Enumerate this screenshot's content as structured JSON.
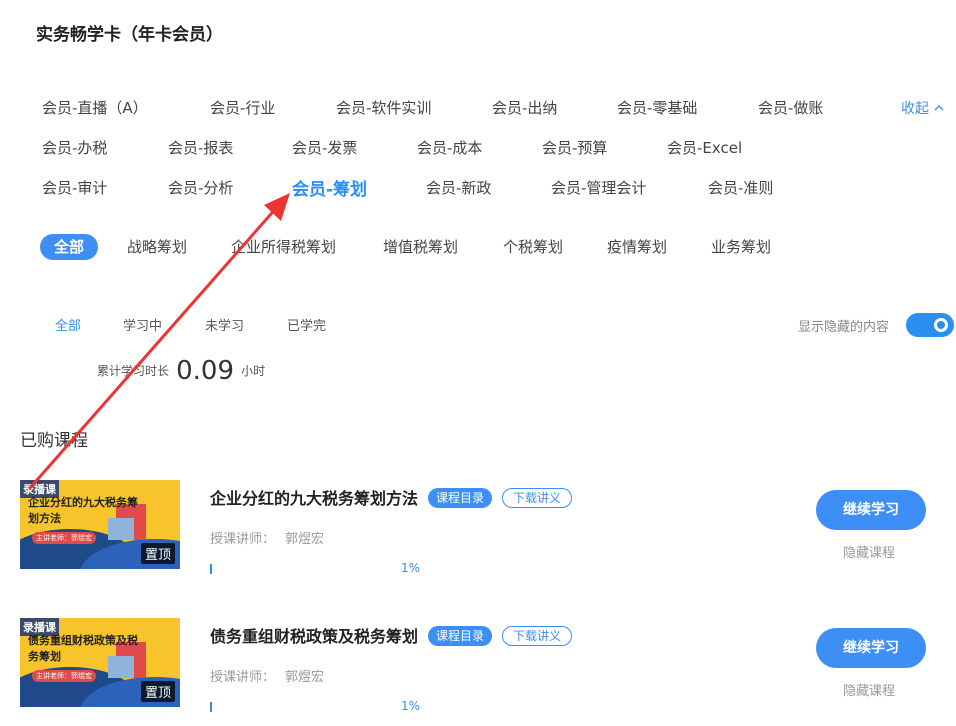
{
  "page_title": "实务畅学卡（年卡会员）",
  "categories": {
    "rows": [
      [
        "会员-直播（A）",
        "会员-行业",
        "会员-软件实训",
        "会员-出纳",
        "会员-零基础",
        "会员-做账"
      ],
      [
        "会员-办税",
        "会员-报表",
        "会员-发票",
        "会员-成本",
        "会员-预算",
        "会员-Excel"
      ],
      [
        "会员-审计",
        "会员-分析",
        "会员-筹划",
        "会员-新政",
        "会员-管理会计",
        "会员-准则"
      ]
    ],
    "active": "会员-筹划",
    "collapse_label": "收起"
  },
  "subcategories": {
    "items": [
      "全部",
      "战略筹划",
      "企业所得税筹划",
      "增值税筹划",
      "个税筹划",
      "疫情筹划",
      "业务筹划"
    ],
    "active": "全部"
  },
  "filters": {
    "items": [
      "全部",
      "学习中",
      "未学习",
      "已学完"
    ],
    "active": "全部"
  },
  "hidden_toggle": {
    "label": "显示隐藏的内容",
    "on": true
  },
  "study_time": {
    "label": "累计学习时长",
    "value": "0.09",
    "unit": "小时"
  },
  "section_title": "已购课程",
  "courses": [
    {
      "thumb_tag": "录播课",
      "thumb_title": "企业分红的九大税务筹划方法",
      "thumb_teacher_chip": "主讲老师：郭煜宏",
      "pin_tag": "置顶",
      "title": "企业分红的九大税务筹划方法",
      "catalog_label": "课程目录",
      "handout_label": "下载讲义",
      "teacher_label": "授课讲师：",
      "teacher_name": "郭煜宏",
      "progress_text": "1%",
      "progress": 0.01,
      "continue_label": "继续学习",
      "hide_label": "隐藏课程"
    },
    {
      "thumb_tag": "录播课",
      "thumb_title": "债务重组财税政策及税务筹划",
      "thumb_teacher_chip": "主讲老师：郭煜宏",
      "pin_tag": "置顶",
      "title": "债务重组财税政策及税务筹划",
      "catalog_label": "课程目录",
      "handout_label": "下载讲义",
      "teacher_label": "授课讲师：",
      "teacher_name": "郭煜宏",
      "progress_text": "1%",
      "progress": 0.01,
      "continue_label": "继续学习",
      "hide_label": "隐藏课程"
    }
  ],
  "colors": {
    "accent": "#3d8ff5",
    "annotation_arrow": "#ee3333"
  }
}
